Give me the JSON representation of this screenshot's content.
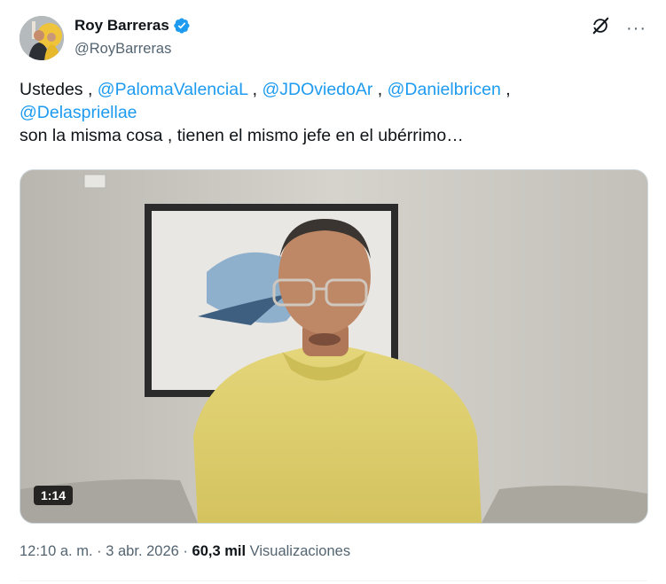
{
  "author": {
    "display_name": "Roy Barreras",
    "handle": "@RoyBarreras",
    "verified": true
  },
  "tweet": {
    "text_start": "Ustedes ,",
    "mentions": [
      "@PalomaValenciaL",
      "@JDOviedoAr",
      "@Danielbricen",
      "@Delaspriellae"
    ],
    "separator": " , ",
    "line_two": "son la misma cosa , tienen el mismo jefe en el ubérrimo…"
  },
  "media": {
    "duration": "1:14"
  },
  "meta": {
    "time": "12:10 a. m.",
    "dot": "·",
    "date": "3 abr. 2026",
    "views_count": "60,3 mil",
    "views_label": "Visualizaciones"
  },
  "icons": {
    "verified": "verified-badge-icon",
    "grok": "grok-icon",
    "more": "more-icon"
  },
  "colors": {
    "link": "#1d9bf0",
    "secondary_text": "#536471",
    "verified": "#1d9bf0"
  }
}
